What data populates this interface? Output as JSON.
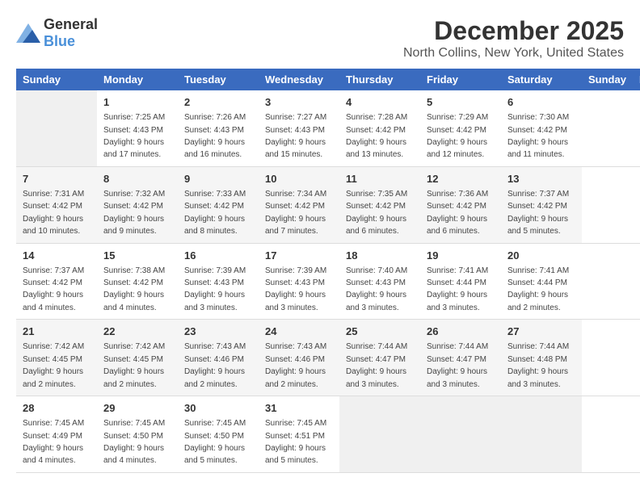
{
  "logo": {
    "text_general": "General",
    "text_blue": "Blue"
  },
  "title": "December 2025",
  "subtitle": "North Collins, New York, United States",
  "days_of_week": [
    "Sunday",
    "Monday",
    "Tuesday",
    "Wednesday",
    "Thursday",
    "Friday",
    "Saturday"
  ],
  "weeks": [
    [
      {
        "day": "",
        "info": ""
      },
      {
        "day": "1",
        "info": "Sunrise: 7:25 AM\nSunset: 4:43 PM\nDaylight: 9 hours\nand 17 minutes."
      },
      {
        "day": "2",
        "info": "Sunrise: 7:26 AM\nSunset: 4:43 PM\nDaylight: 9 hours\nand 16 minutes."
      },
      {
        "day": "3",
        "info": "Sunrise: 7:27 AM\nSunset: 4:43 PM\nDaylight: 9 hours\nand 15 minutes."
      },
      {
        "day": "4",
        "info": "Sunrise: 7:28 AM\nSunset: 4:42 PM\nDaylight: 9 hours\nand 13 minutes."
      },
      {
        "day": "5",
        "info": "Sunrise: 7:29 AM\nSunset: 4:42 PM\nDaylight: 9 hours\nand 12 minutes."
      },
      {
        "day": "6",
        "info": "Sunrise: 7:30 AM\nSunset: 4:42 PM\nDaylight: 9 hours\nand 11 minutes."
      }
    ],
    [
      {
        "day": "7",
        "info": "Sunrise: 7:31 AM\nSunset: 4:42 PM\nDaylight: 9 hours\nand 10 minutes."
      },
      {
        "day": "8",
        "info": "Sunrise: 7:32 AM\nSunset: 4:42 PM\nDaylight: 9 hours\nand 9 minutes."
      },
      {
        "day": "9",
        "info": "Sunrise: 7:33 AM\nSunset: 4:42 PM\nDaylight: 9 hours\nand 8 minutes."
      },
      {
        "day": "10",
        "info": "Sunrise: 7:34 AM\nSunset: 4:42 PM\nDaylight: 9 hours\nand 7 minutes."
      },
      {
        "day": "11",
        "info": "Sunrise: 7:35 AM\nSunset: 4:42 PM\nDaylight: 9 hours\nand 6 minutes."
      },
      {
        "day": "12",
        "info": "Sunrise: 7:36 AM\nSunset: 4:42 PM\nDaylight: 9 hours\nand 6 minutes."
      },
      {
        "day": "13",
        "info": "Sunrise: 7:37 AM\nSunset: 4:42 PM\nDaylight: 9 hours\nand 5 minutes."
      }
    ],
    [
      {
        "day": "14",
        "info": "Sunrise: 7:37 AM\nSunset: 4:42 PM\nDaylight: 9 hours\nand 4 minutes."
      },
      {
        "day": "15",
        "info": "Sunrise: 7:38 AM\nSunset: 4:42 PM\nDaylight: 9 hours\nand 4 minutes."
      },
      {
        "day": "16",
        "info": "Sunrise: 7:39 AM\nSunset: 4:43 PM\nDaylight: 9 hours\nand 3 minutes."
      },
      {
        "day": "17",
        "info": "Sunrise: 7:39 AM\nSunset: 4:43 PM\nDaylight: 9 hours\nand 3 minutes."
      },
      {
        "day": "18",
        "info": "Sunrise: 7:40 AM\nSunset: 4:43 PM\nDaylight: 9 hours\nand 3 minutes."
      },
      {
        "day": "19",
        "info": "Sunrise: 7:41 AM\nSunset: 4:44 PM\nDaylight: 9 hours\nand 3 minutes."
      },
      {
        "day": "20",
        "info": "Sunrise: 7:41 AM\nSunset: 4:44 PM\nDaylight: 9 hours\nand 2 minutes."
      }
    ],
    [
      {
        "day": "21",
        "info": "Sunrise: 7:42 AM\nSunset: 4:45 PM\nDaylight: 9 hours\nand 2 minutes."
      },
      {
        "day": "22",
        "info": "Sunrise: 7:42 AM\nSunset: 4:45 PM\nDaylight: 9 hours\nand 2 minutes."
      },
      {
        "day": "23",
        "info": "Sunrise: 7:43 AM\nSunset: 4:46 PM\nDaylight: 9 hours\nand 2 minutes."
      },
      {
        "day": "24",
        "info": "Sunrise: 7:43 AM\nSunset: 4:46 PM\nDaylight: 9 hours\nand 2 minutes."
      },
      {
        "day": "25",
        "info": "Sunrise: 7:44 AM\nSunset: 4:47 PM\nDaylight: 9 hours\nand 3 minutes."
      },
      {
        "day": "26",
        "info": "Sunrise: 7:44 AM\nSunset: 4:47 PM\nDaylight: 9 hours\nand 3 minutes."
      },
      {
        "day": "27",
        "info": "Sunrise: 7:44 AM\nSunset: 4:48 PM\nDaylight: 9 hours\nand 3 minutes."
      }
    ],
    [
      {
        "day": "28",
        "info": "Sunrise: 7:45 AM\nSunset: 4:49 PM\nDaylight: 9 hours\nand 4 minutes."
      },
      {
        "day": "29",
        "info": "Sunrise: 7:45 AM\nSunset: 4:50 PM\nDaylight: 9 hours\nand 4 minutes."
      },
      {
        "day": "30",
        "info": "Sunrise: 7:45 AM\nSunset: 4:50 PM\nDaylight: 9 hours\nand 5 minutes."
      },
      {
        "day": "31",
        "info": "Sunrise: 7:45 AM\nSunset: 4:51 PM\nDaylight: 9 hours\nand 5 minutes."
      },
      {
        "day": "",
        "info": ""
      },
      {
        "day": "",
        "info": ""
      },
      {
        "day": "",
        "info": ""
      }
    ]
  ]
}
